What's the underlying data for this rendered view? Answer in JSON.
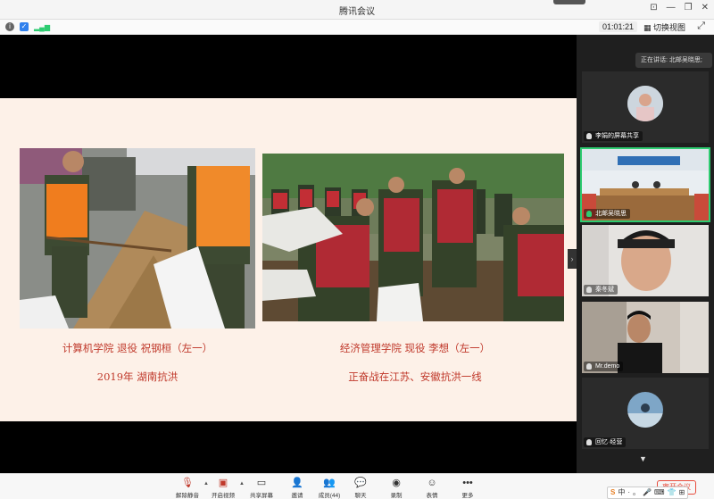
{
  "window": {
    "title": "腾讯会议"
  },
  "infobar": {
    "timer": "01:01:21",
    "switch_view": "切换视图"
  },
  "slide": {
    "left_caption_line1": "计算机学院  退役  祝钢桓（左一）",
    "left_caption_line2": "2019年 湖南抗洪",
    "right_caption_line1": "经济管理学院  现役  李想（左一）",
    "right_caption_line2": "正奋战在江苏、安徽抗洪一线"
  },
  "sidebar": {
    "speaking": "正在讲话: 北邮吴晓思;",
    "tiles": [
      {
        "label": "李娟的屏幕共享"
      },
      {
        "label": "北邮吴晓思"
      },
      {
        "label": "秦冬斌"
      },
      {
        "label": "Mr.demo"
      },
      {
        "label": "回忆·经营"
      }
    ]
  },
  "toolbar": {
    "buttons": [
      {
        "label": "解除静音",
        "icon": "mic-icon"
      },
      {
        "label": "开启视频",
        "icon": "camera-icon"
      },
      {
        "label": "共享屏幕",
        "icon": "screen-share-icon"
      },
      {
        "label": "邀请",
        "icon": "invite-icon"
      },
      {
        "label": "成员(44)",
        "icon": "members-icon"
      },
      {
        "label": "聊天",
        "icon": "chat-icon"
      },
      {
        "label": "录制",
        "icon": "record-icon"
      },
      {
        "label": "表情",
        "icon": "emoji-icon"
      },
      {
        "label": "更多",
        "icon": "more-icon"
      }
    ],
    "end_meeting": "离开会议",
    "ime": [
      "S",
      "中",
      "·",
      "。",
      "🎤",
      "⌨",
      "👕",
      "⊞"
    ]
  },
  "colors": {
    "caption_red": "#c0392b",
    "active_green": "#2ecc71",
    "slide_bg": "#fdf1e8"
  }
}
